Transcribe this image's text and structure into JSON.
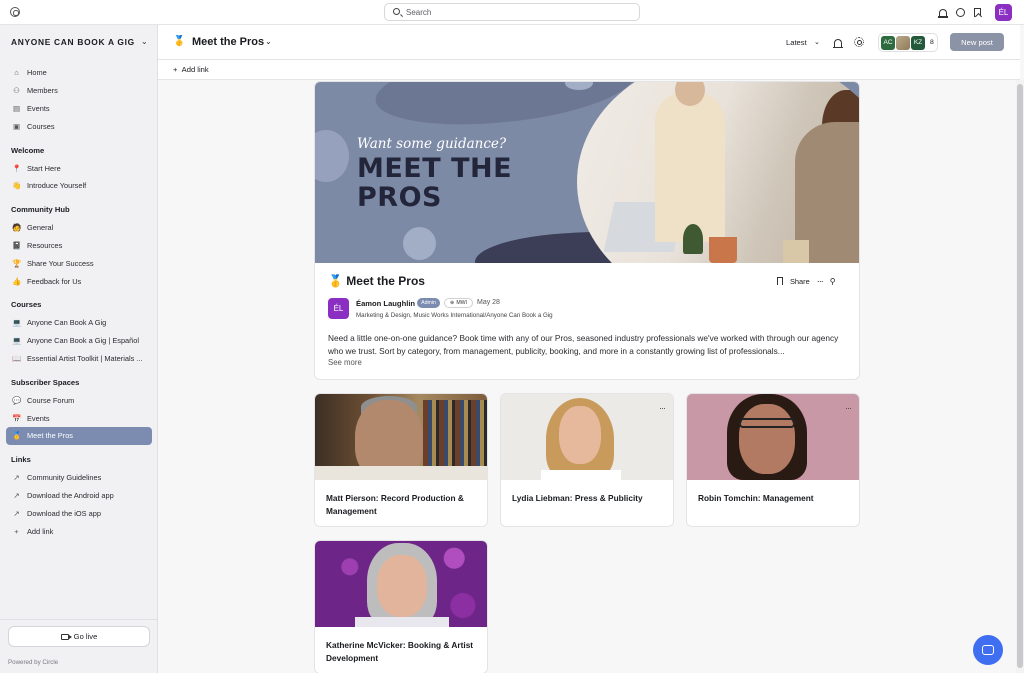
{
  "topbar": {
    "search_placeholder": "Search",
    "avatar_initials": "ÉL"
  },
  "sidebar": {
    "community_name": "ANYONE CAN BOOK A GIG",
    "main": [
      {
        "icon": "home-icon",
        "glyph": "⌂",
        "label": "Home"
      },
      {
        "icon": "members-icon",
        "glyph": "⚇",
        "label": "Members"
      },
      {
        "icon": "calendar-icon",
        "glyph": "▤",
        "label": "Events"
      },
      {
        "icon": "courses-icon",
        "glyph": "▣",
        "label": "Courses"
      }
    ],
    "groups": [
      {
        "title": "Welcome",
        "items": [
          {
            "icon": "pin-emoji-icon",
            "glyph": "📍",
            "label": "Start Here"
          },
          {
            "icon": "wave-emoji-icon",
            "glyph": "👋",
            "label": "Introduce Yourself"
          }
        ]
      },
      {
        "title": "Community Hub",
        "items": [
          {
            "icon": "people-emoji-icon",
            "glyph": "🧑",
            "label": "General"
          },
          {
            "icon": "book-emoji-icon",
            "glyph": "📓",
            "label": "Resources"
          },
          {
            "icon": "trophy-emoji-icon",
            "glyph": "🏆",
            "label": "Share Your Success"
          },
          {
            "icon": "thumbs-up-emoji-icon",
            "glyph": "👍",
            "label": "Feedback for Us"
          }
        ]
      },
      {
        "title": "Courses",
        "items": [
          {
            "icon": "laptop-emoji-icon",
            "glyph": "💻",
            "label": "Anyone Can Book A Gig"
          },
          {
            "icon": "laptop-emoji-icon",
            "glyph": "💻",
            "label": "Anyone Can Book a Gig | Español"
          },
          {
            "icon": "book-open-emoji-icon",
            "glyph": "📖",
            "label": "Essential Artist Toolkit | Materials ..."
          }
        ]
      },
      {
        "title": "Subscriber Spaces",
        "items": [
          {
            "icon": "speech-emoji-icon",
            "glyph": "💬",
            "label": "Course Forum"
          },
          {
            "icon": "calendar-emoji-icon",
            "glyph": "📅",
            "label": "Events"
          },
          {
            "icon": "medal-emoji-icon",
            "glyph": "🥇",
            "label": "Meet the Pros",
            "active": true
          }
        ]
      },
      {
        "title": "Links",
        "items": [
          {
            "icon": "arrow-up-right-icon",
            "glyph": "↗",
            "label": "Community Guidelines"
          },
          {
            "icon": "arrow-up-right-icon",
            "glyph": "↗",
            "label": "Download the Android app"
          },
          {
            "icon": "arrow-up-right-icon",
            "glyph": "↗",
            "label": "Download the iOS app"
          },
          {
            "icon": "plus-icon",
            "glyph": "+",
            "label": "Add link"
          }
        ]
      }
    ],
    "go_live": "Go live",
    "powered_by": "Powered by Circle"
  },
  "header": {
    "space_icon": "🥇",
    "space_title": "Meet the Pros",
    "sort": "Latest",
    "member_initials": [
      "AC",
      "",
      "KZ"
    ],
    "member_count": "8",
    "new_post": "New post",
    "add_link": "Add link"
  },
  "post": {
    "banner_tagline": "Want some guidance?",
    "banner_line1": "MEET THE",
    "banner_line2": "PROS",
    "title_icon": "🥇",
    "title": "Meet the Pros",
    "share": "Share",
    "author_initials": "ÉL",
    "author_name": "Éamon Laughlin",
    "admin_badge": "Admin",
    "mwi_badge": "MWI",
    "date": "May 28",
    "author_subtitle": "Marketing & Design, Music Works International/Anyone Can Book a Gig",
    "body": "Need a little one-on-one guidance? Book time with any of our Pros, seasoned industry professionals we've worked with through our agency who we trust. Sort by category, from management, publicity, booking, and more in a constantly growing list of professionals...",
    "see_more": "See more"
  },
  "pros": [
    {
      "name": "Matt Pierson: Record Production & Management"
    },
    {
      "name": "Lydia Liebman: Press & Publicity"
    },
    {
      "name": "Robin Tomchin: Management"
    },
    {
      "name": "Katherine McVicker: Booking & Artist Development"
    }
  ],
  "colors": {
    "accent": "#7b8cb0",
    "avatar": "#8a2fc1",
    "chat_fab": "#3f6ef0"
  }
}
